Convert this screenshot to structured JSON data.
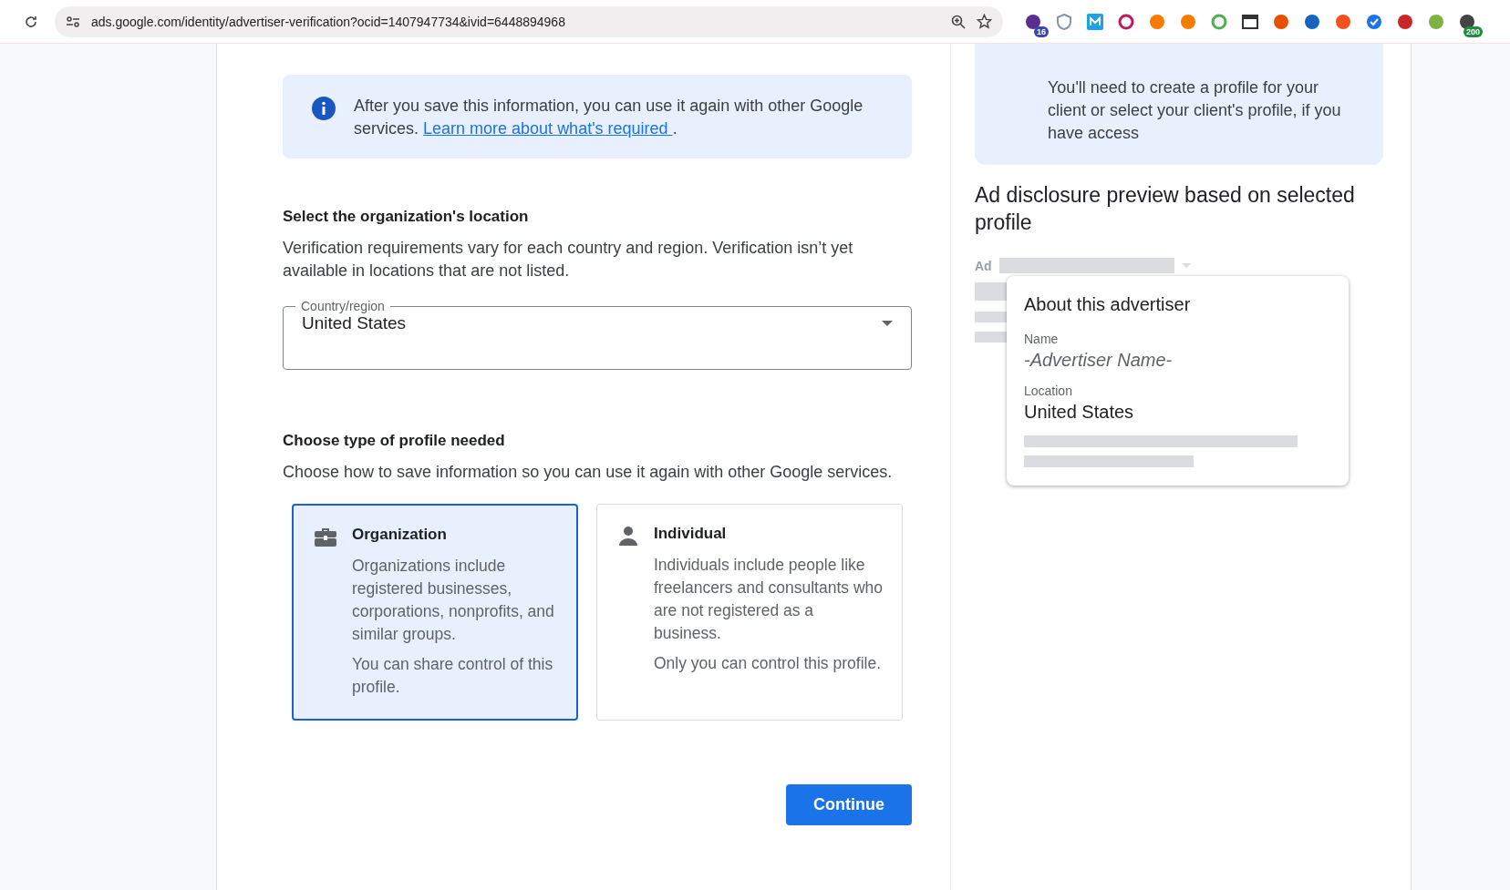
{
  "browser": {
    "url": "ads.google.com/identity/advertiser-verification?ocid=1407947734&ivid=6448894968",
    "extensions": [
      {
        "kind": "cap",
        "badge": "16"
      },
      {
        "kind": "shield"
      },
      {
        "kind": "m"
      },
      {
        "kind": "ring"
      },
      {
        "kind": "coin"
      },
      {
        "kind": "coin"
      },
      {
        "kind": "rainbow"
      },
      {
        "kind": "window"
      },
      {
        "kind": "swirl"
      },
      {
        "kind": "pin"
      },
      {
        "kind": "figure"
      },
      {
        "kind": "check"
      },
      {
        "kind": "stop"
      },
      {
        "kind": "w"
      },
      {
        "kind": "lock",
        "badge": "200"
      }
    ]
  },
  "info": {
    "text": "After you save this information, you can use it again with other Google services.",
    "link": "Learn more about what's required ",
    "after": "."
  },
  "location": {
    "heading": "Select the organization's location",
    "description": "Verification requirements vary for each country and region. Verification isn’t yet available in locations that are not listed.",
    "field": {
      "label": "Country/region",
      "value": "United States"
    }
  },
  "profile": {
    "heading": "Choose type of profile needed",
    "description": "Choose how to save information so you can use it again with other Google services.",
    "options": [
      {
        "kind": "organization",
        "title": "Organization",
        "text": "Organizations include registered businesses, corporations, nonprofits, and similar groups.",
        "note": "You can share control of this profile.",
        "selected": true
      },
      {
        "kind": "individual",
        "title": "Individual",
        "text": "Individuals include people like freelancers and consultants who are not registered as a business.",
        "note": "Only you can control this profile.",
        "selected": false
      }
    ]
  },
  "continue_button": "Continue",
  "side": {
    "notice": "You'll need to create a profile for your client or select your client's profile, if you have access",
    "heading": "Ad disclosure preview based on selected profile",
    "ad_label": "Ad",
    "popup": {
      "title": "About this advertiser",
      "name_label": "Name",
      "name_value": "-Advertiser Name-",
      "location_label": "Location",
      "location_value": "United States"
    }
  }
}
